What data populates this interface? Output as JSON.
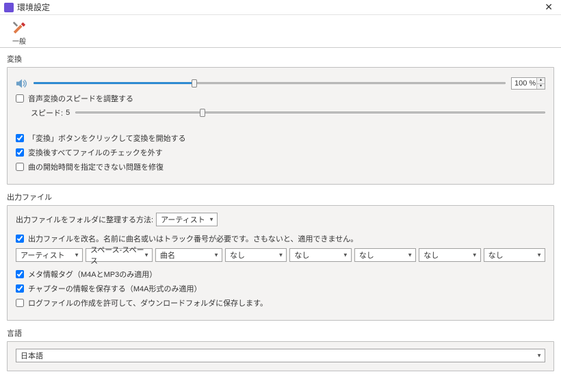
{
  "window": {
    "title": "環境設定"
  },
  "toolbar": {
    "general_tab": "一般"
  },
  "conversion": {
    "section_label": "変換",
    "volume_value": "100 %",
    "volume_percent": 34,
    "adjust_speed_label": "音声変換のスピードを調整する",
    "adjust_speed_checked": false,
    "speed_label": "スピード:",
    "speed_value": "5",
    "speed_percent": 27,
    "start_on_click_label": "「変換」ボタンをクリックして変換を開始する",
    "start_on_click_checked": true,
    "uncheck_after_label": "変換後すべてファイルのチェックを外す",
    "uncheck_after_checked": true,
    "fix_start_time_label": "曲の開始時間を指定できない問題を修復",
    "fix_start_time_checked": false
  },
  "output": {
    "section_label": "出力ファイル",
    "organize_label": "出力ファイルをフォルダに整理する方法:",
    "organize_value": "アーティスト",
    "rename_checked": true,
    "rename_label": "出力ファイルを改名。名前に曲名或いはトラック番号が必要です。さもないと、適用できません。",
    "rename_parts": [
      "アーティスト",
      "スペース-スペース",
      "曲名",
      "なし",
      "なし",
      "なし",
      "なし",
      "なし"
    ],
    "meta_tag_checked": true,
    "meta_tag_label": "メタ情報タグ（M4AとMP3のみ適用）",
    "chapter_checked": true,
    "chapter_label": "チャプターの情報を保存する（M4A形式のみ適用）",
    "logfile_checked": false,
    "logfile_label": "ログファイルの作成を許可して、ダウンロードフォルダに保存します。"
  },
  "language": {
    "section_label": "言語",
    "value": "日本語"
  }
}
